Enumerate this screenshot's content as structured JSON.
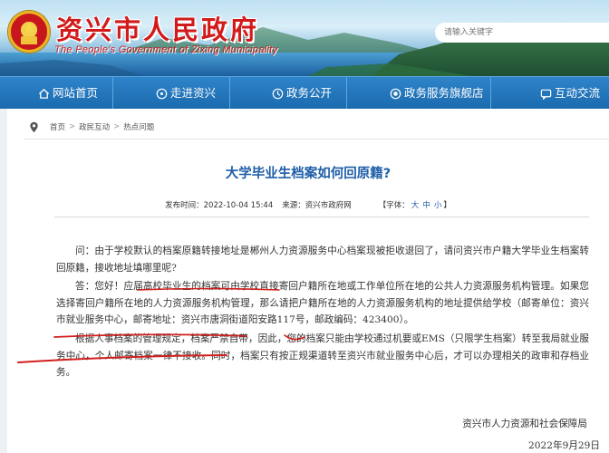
{
  "header": {
    "site_title": "资兴市人民政府",
    "site_subtitle": "The People's Government of Zixing Municipality",
    "search_placeholder": "请输入关键字"
  },
  "nav": {
    "items": [
      {
        "label": "网站首页",
        "icon": "home-icon"
      },
      {
        "label": "走进资兴",
        "icon": "compass-icon"
      },
      {
        "label": "政务公开",
        "icon": "document-icon"
      },
      {
        "label": "政务服务旗舰店",
        "icon": "service-icon"
      },
      {
        "label": "互动交流",
        "icon": "chat-icon"
      }
    ]
  },
  "breadcrumb": {
    "icon": "location-pin-icon",
    "items": [
      "首页",
      "政民互动",
      "热点问题"
    ],
    "separator": ">"
  },
  "article": {
    "title": "大学毕业生档案如何回原籍?",
    "meta": {
      "published_label": "发布时间：",
      "published_value": "2022-10-04 15:44",
      "source_label": "来源：",
      "source_value": "资兴市政府网",
      "font_label": "【字体：",
      "font_options": [
        "大",
        "中",
        "小"
      ],
      "font_close": "】"
    },
    "paragraphs": [
      "问：由于学校默认的档案原籍转接地址是郴州人力资源服务中心档案现被拒收退回了，请问资兴市户籍大学毕业生档案转回原籍，接收地址填哪里呢?",
      "答：您好！应届高校毕业生的档案可由学校直接寄回户籍所在地或工作单位所在地的公共人力资源服务机构管理。如果您选择寄回户籍所在地的人力资源服务机构管理，那么请把户籍所在地的人力资源服务机构的地址提供给学校（邮寄单位：资兴市就业服务中心，邮寄地址：资兴市唐洞街道阳安路117号，邮政编码：423400）。",
      "根据人事档案的管理规定，档案严禁自带，因此，您的档案只能由学校通过机要或EMS（只限学生档案）转至我局就业服务中心，个人邮寄档案一律不接收。同时，档案只有按正规渠道转至资兴市就业服务中心后，才可以办理相关的政审和存档业务。"
    ],
    "signature": "资兴市人力资源和社会保障局",
    "date": "2022年9月29日"
  },
  "colors": {
    "nav_bg": "#1f70b5",
    "title_red": "#d21a1a",
    "article_title": "#1f5ea8",
    "annotation_ink": "#d0201e"
  }
}
